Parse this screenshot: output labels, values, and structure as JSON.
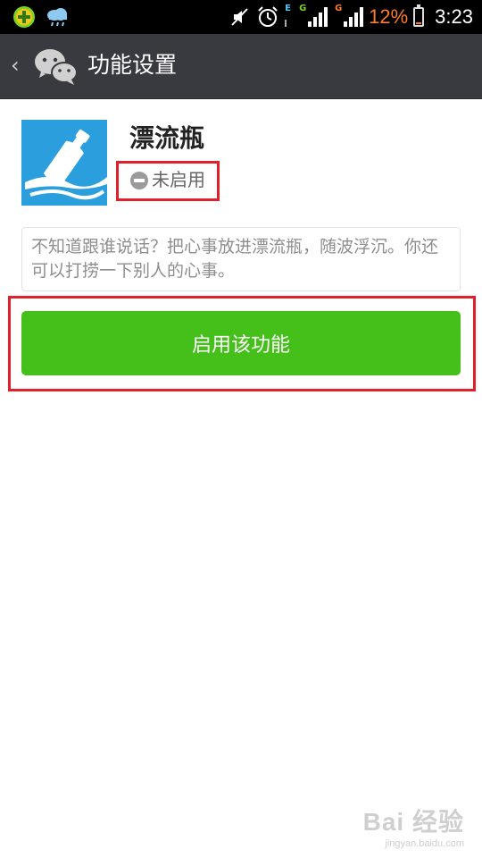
{
  "status_bar": {
    "battery_percent": "12%",
    "time": "3:23",
    "network_1": "E",
    "network_2": "G",
    "network_3": "G",
    "battery_level": 0.12
  },
  "header": {
    "title": "功能设置",
    "back_icon": "chevron-left-icon",
    "app_icon": "wechat-logo-icon"
  },
  "feature": {
    "name": "漂流瓶",
    "status": "未启用",
    "status_icon": "disabled-icon",
    "icon": "drift-bottle-icon",
    "description": "不知道跟谁说话？把心事放进漂流瓶，随波浮沉。你还可以打捞一下别人的心事。"
  },
  "actions": {
    "enable_label": "启用该功能"
  },
  "watermark": {
    "top": "Bai 经验",
    "bottom": "jingyan.baidu.com"
  },
  "colors": {
    "action_bar": "#393a3f",
    "primary_button": "#45c01a",
    "highlight_box": "#e0202a",
    "feature_icon_bg": "#2b9fde",
    "battery_text": "#ff7a2a"
  }
}
